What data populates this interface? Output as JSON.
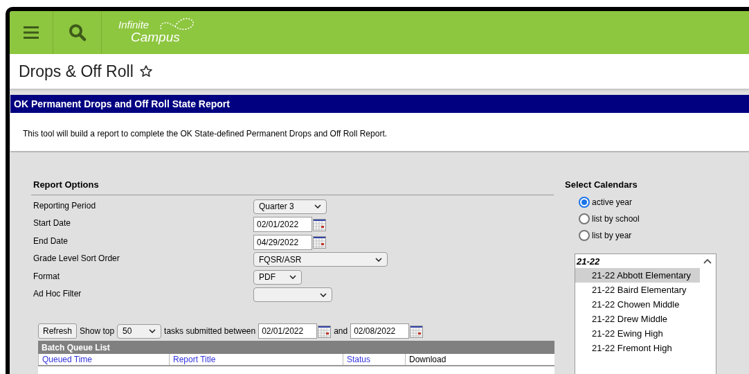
{
  "header": {
    "logo": {
      "line1": "Infinite",
      "line2": "Campus"
    }
  },
  "page": {
    "title": "Drops & Off Roll",
    "favorite": false
  },
  "report": {
    "title": "OK Permanent Drops and Off Roll State Report",
    "description": "This tool will build a report to complete the OK State-defined Permanent Drops and Off Roll Report."
  },
  "report_options": {
    "heading": "Report Options",
    "fields": [
      {
        "kind": "select",
        "label": "Reporting Period",
        "value": "Quarter 3"
      },
      {
        "kind": "date",
        "label": "Start Date",
        "value": "02/01/2022"
      },
      {
        "kind": "date",
        "label": "End Date",
        "value": "04/29/2022"
      },
      {
        "kind": "select",
        "label": "Grade Level Sort Order",
        "value": "FQSR/ASR"
      },
      {
        "kind": "select",
        "label": "Format",
        "value": "PDF"
      },
      {
        "kind": "select",
        "label": "Ad Hoc Filter"
      }
    ]
  },
  "batch": {
    "refresh": "Refresh",
    "show_top": "Show top",
    "top_count": "50",
    "between": "tasks submitted between",
    "from": "02/01/2022",
    "and": "and",
    "to": "02/08/2022",
    "title": "Batch Queue List",
    "columns": [
      "Queued Time",
      "Report Title",
      "Status",
      "Download"
    ]
  },
  "calendars": {
    "heading": "Select Calendars",
    "modes": [
      {
        "label": "active year",
        "selected": true
      },
      {
        "label": "list by school",
        "selected": false
      },
      {
        "label": "list by year",
        "selected": false
      }
    ],
    "groups": [
      {
        "label": "21-22",
        "items": [
          {
            "label": "21-22 Abbott Elementary",
            "selected": true
          },
          {
            "label": "21-22 Baird Elementary",
            "selected": false
          },
          {
            "label": "21-22 Chowen Middle",
            "selected": false
          },
          {
            "label": "21-22 Drew Middle",
            "selected": false
          },
          {
            "label": "21-22 Ewing High",
            "selected": false
          },
          {
            "label": "21-22 Fremont High",
            "selected": false
          }
        ]
      }
    ]
  }
}
